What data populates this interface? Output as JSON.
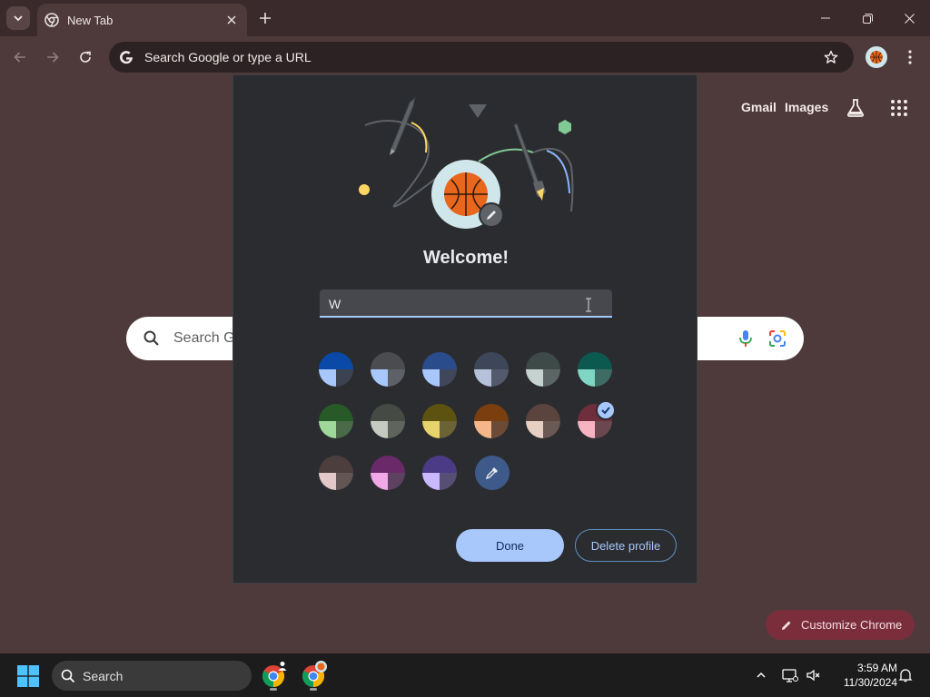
{
  "browser": {
    "tab_title": "New Tab",
    "omnibox_placeholder": "Search Google or type a URL"
  },
  "ntp": {
    "gmail": "Gmail",
    "images": "Images",
    "search_placeholder": "Search Google or type a URL",
    "search_visible_text": "Search G",
    "customize_label": "Customize Chrome"
  },
  "dialog": {
    "title": "Welcome!",
    "name_value": "W",
    "done_label": "Done",
    "delete_label": "Delete profile",
    "color_swatches": [
      {
        "top": "#0b49a8",
        "left": "#a8c7fa",
        "right": "#3c4350",
        "selected": false
      },
      {
        "top": "#4a4c50",
        "left": "#a8c7fa",
        "right": "#5d6066",
        "selected": false
      },
      {
        "top": "#2a4c8a",
        "left": "#a8c7fa",
        "right": "#40475a",
        "selected": false
      },
      {
        "top": "#3e4759",
        "left": "#b6c2d9",
        "right": "#525a6b",
        "selected": false
      },
      {
        "top": "#3d4a47",
        "left": "#c6d2cf",
        "right": "#5b6664",
        "selected": false
      },
      {
        "top": "#0c5a4f",
        "left": "#7fd6c4",
        "right": "#3e6b63",
        "selected": false
      },
      {
        "top": "#285a28",
        "left": "#9fd89a",
        "right": "#4a6a48",
        "selected": false
      },
      {
        "top": "#454b44",
        "left": "#c5cbc0",
        "right": "#5f645c",
        "selected": false
      },
      {
        "top": "#5e5210",
        "left": "#e6d36b",
        "right": "#6b6235",
        "selected": false
      },
      {
        "top": "#7a3e0f",
        "left": "#f5b78a",
        "right": "#6b4a36",
        "selected": false
      },
      {
        "top": "#5a443d",
        "left": "#e8cfc4",
        "right": "#6b5a54",
        "selected": false
      },
      {
        "top": "#6e2e3c",
        "left": "#f6b3c1",
        "right": "#6b4850",
        "selected": true
      },
      {
        "top": "#4d3e3e",
        "left": "#e2c8c6",
        "right": "#625554",
        "selected": false
      },
      {
        "top": "#6a2a6a",
        "left": "#f0a8e8",
        "right": "#5e4060",
        "selected": false
      },
      {
        "top": "#4b3b86",
        "left": "#cbb9ff",
        "right": "#574e75",
        "selected": false
      }
    ]
  },
  "taskbar": {
    "search_label": "Search",
    "time": "3:59 AM",
    "date": "11/30/2024"
  },
  "colors": {
    "page_bg": "#4e3a3b",
    "titlebar_bg": "#3a2a2b",
    "dialog_bg": "#2b2c30",
    "accent": "#a8c7fa",
    "customize_bg": "#7a2e3c"
  },
  "icons": [
    "chevron-down-icon",
    "chrome-icon",
    "close-icon",
    "plus-icon",
    "minimize-icon",
    "restore-icon",
    "back-icon",
    "forward-icon",
    "reload-icon",
    "google-g-icon",
    "star-icon",
    "basketball-avatar-icon",
    "kebab-menu-icon",
    "labs-flask-icon",
    "apps-grid-icon",
    "search-icon",
    "mic-icon",
    "lens-icon",
    "pencil-icon",
    "eyedropper-icon",
    "check-icon",
    "windows-start-icon",
    "chevron-up-icon",
    "network-icon",
    "volume-muted-icon",
    "bell-icon"
  ]
}
